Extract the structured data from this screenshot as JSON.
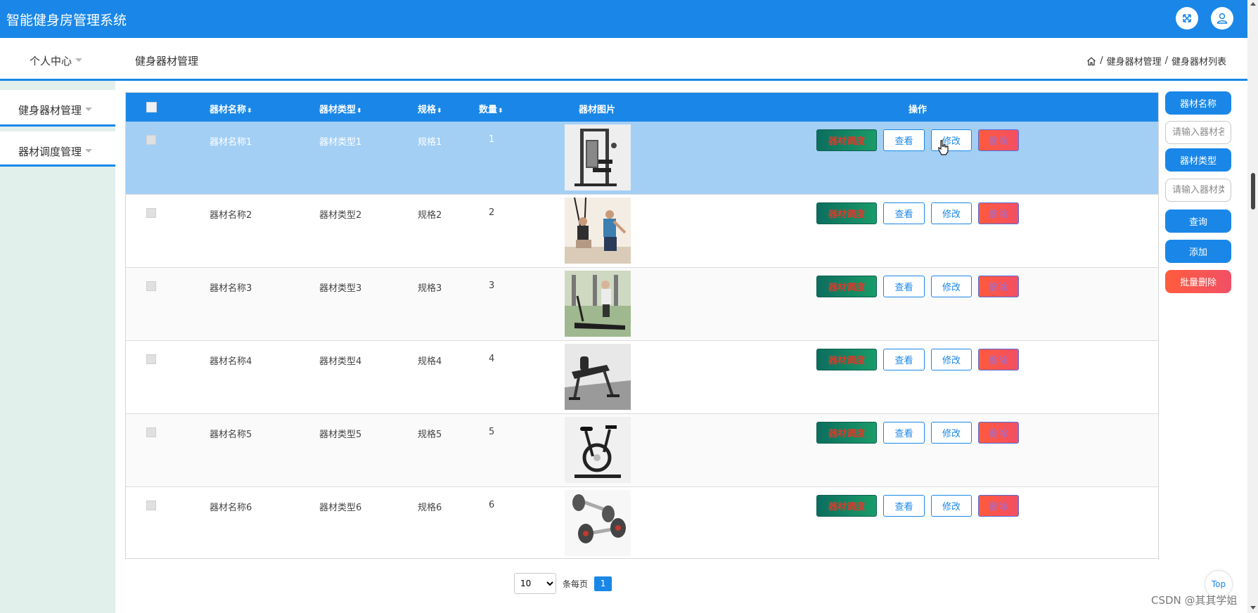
{
  "header": {
    "title": "智能健身房管理系统",
    "fullscreen_icon": "fullscreen-icon",
    "user_icon": "user-icon"
  },
  "subheader": {
    "personal_center": "个人中心",
    "module_title": "健身器材管理",
    "breadcrumb": [
      "健身器材管理",
      "健身器材列表"
    ],
    "breadcrumb_sep": "/"
  },
  "sidebar": {
    "items": [
      {
        "label": "健身器材管理"
      },
      {
        "label": "器材调度管理"
      }
    ]
  },
  "table": {
    "headers": {
      "name": "器材名称",
      "type": "器材类型",
      "spec": "规格",
      "qty": "数量",
      "image": "器材图片",
      "actions": "操作"
    },
    "sort_icon": "⬍",
    "rows": [
      {
        "name": "器材名称1",
        "type": "器材类型1",
        "spec": "规格1",
        "qty": "1",
        "image": "home-gym-machine"
      },
      {
        "name": "器材名称2",
        "type": "器材类型2",
        "spec": "规格2",
        "qty": "2",
        "image": "suspension-trainer"
      },
      {
        "name": "器材名称3",
        "type": "器材类型3",
        "spec": "规格3",
        "qty": "3",
        "image": "treadmill"
      },
      {
        "name": "器材名称4",
        "type": "器材类型4",
        "spec": "规格4",
        "qty": "4",
        "image": "weight-bench"
      },
      {
        "name": "器材名称5",
        "type": "器材类型5",
        "spec": "规格5",
        "qty": "5",
        "image": "spin-bike"
      },
      {
        "name": "器材名称6",
        "type": "器材类型6",
        "spec": "规格6",
        "qty": "6",
        "image": "dumbbells"
      }
    ],
    "actions": {
      "dispatch": "器材调度",
      "view": "查看",
      "edit": "修改",
      "delete": "删除"
    }
  },
  "search": {
    "name_label": "器材名称",
    "name_placeholder": "请输入器材名称",
    "type_label": "器材类型",
    "type_placeholder": "请输入器材类型",
    "query": "查询",
    "add": "添加",
    "batch_delete": "批量删除"
  },
  "pagination": {
    "page_size": "10",
    "page_size_options": [
      "10"
    ],
    "per_page_label": "条每页",
    "current_page": "1"
  },
  "misc": {
    "top_button": "Top",
    "watermark": "CSDN @其其学姐"
  },
  "colors": {
    "primary": "#1a87e8",
    "active_row": "#a3cff5",
    "sidebar_bg": "#e2f0ec",
    "dispatch": "#0c6e5e",
    "danger": "#ff5a3c"
  }
}
